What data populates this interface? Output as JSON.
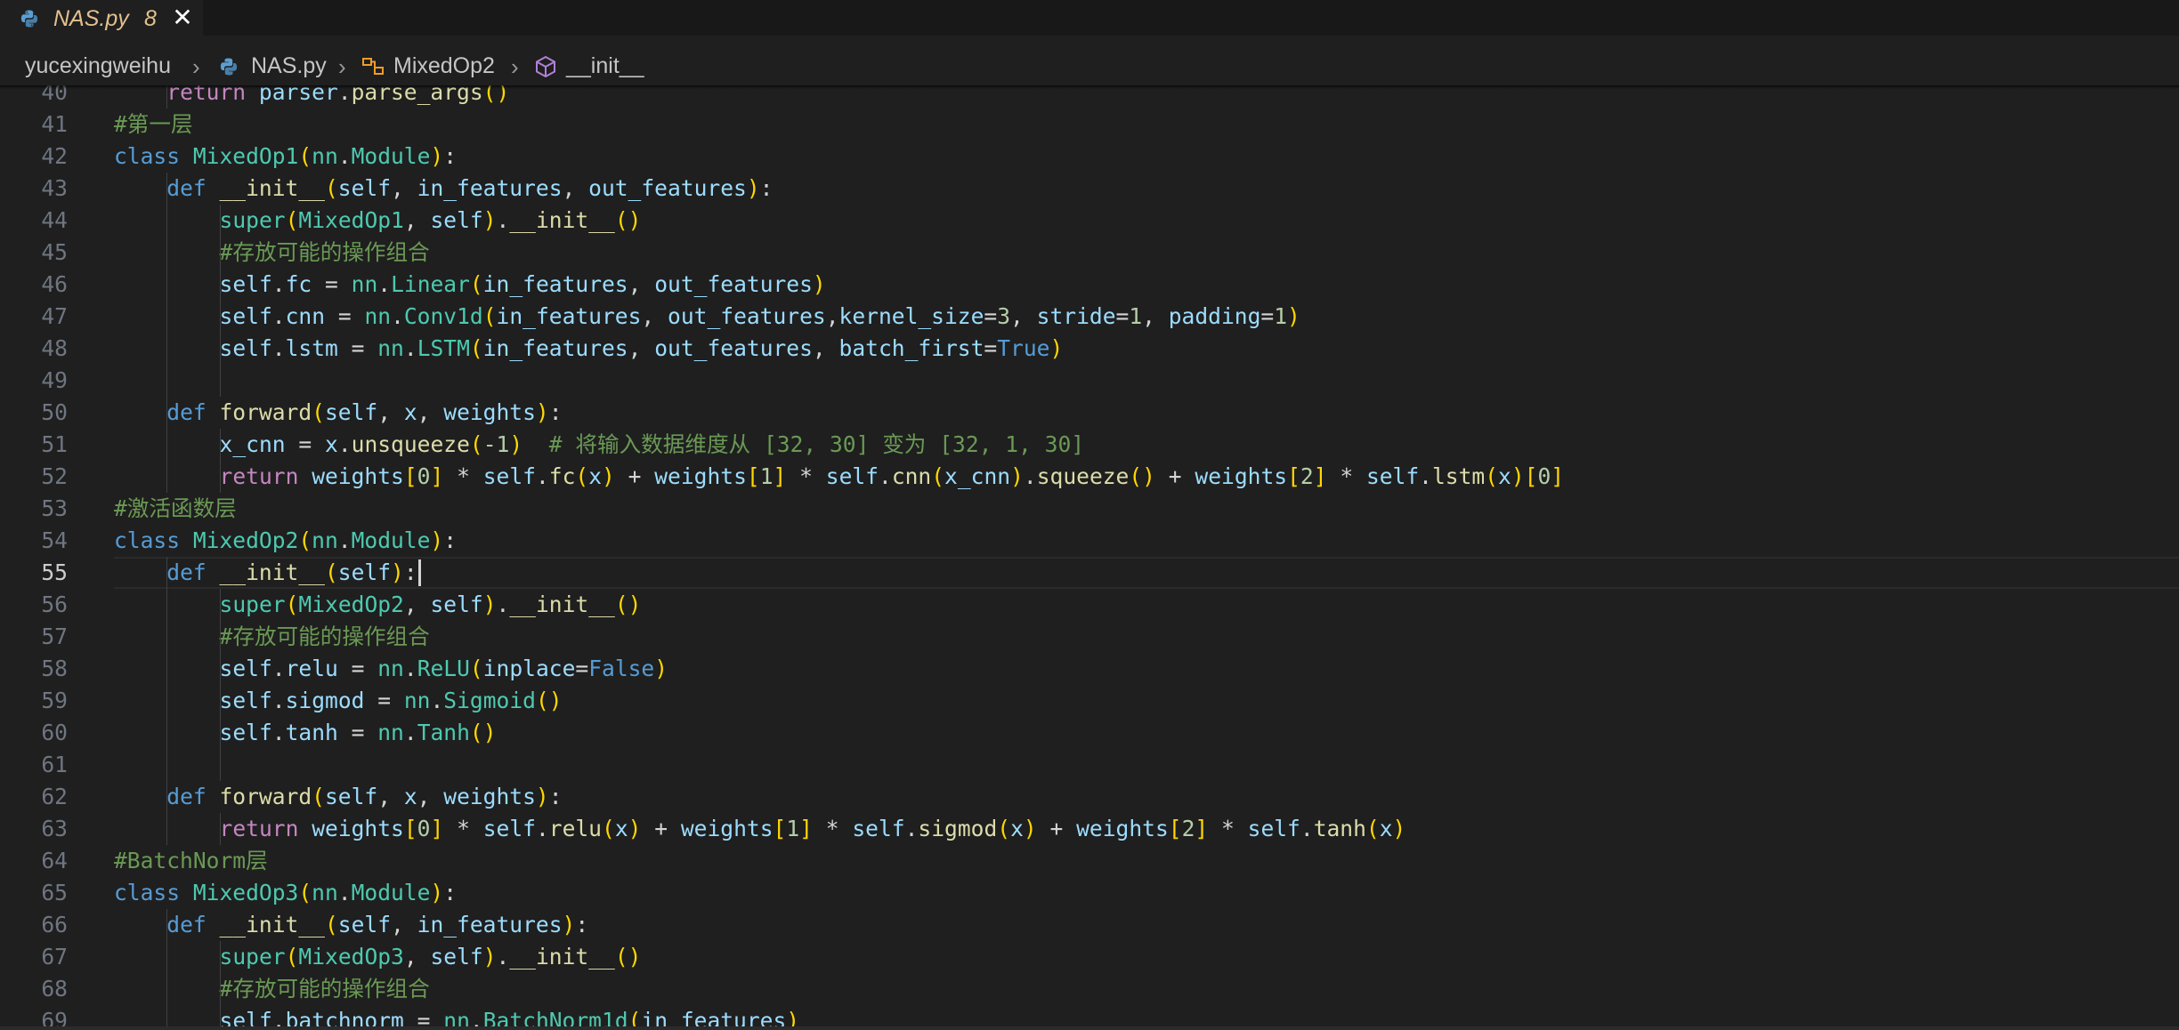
{
  "tab": {
    "filename": "NAS.py",
    "problem_count": "8",
    "close_symbol": "✕",
    "icon": "python-icon"
  },
  "breadcrumb": [
    {
      "label": "yucexingweihu",
      "icon": ""
    },
    {
      "label": "NAS.py",
      "icon": "python-icon"
    },
    {
      "label": "MixedOp2",
      "icon": "class-icon"
    },
    {
      "label": "__init__",
      "icon": "method-icon"
    }
  ],
  "colors": {
    "keyword": "#569cd6",
    "control": "#c586c0",
    "function": "#dcdcaa",
    "class": "#4ec9b0",
    "variable": "#9cdcfe",
    "number": "#b5cea8",
    "string": "#ce9178",
    "comment": "#6a9955",
    "bracket1": "#ffd700",
    "bracket2": "#da70d6",
    "bracket3": "#179fff",
    "plain": "#d4d4d4"
  },
  "current_line": 55,
  "lines": [
    {
      "n": "40",
      "indent": 1,
      "tokens": [
        [
          "return",
          "control"
        ],
        [
          " ",
          ""
        ],
        [
          "parser",
          "variable"
        ],
        [
          ".",
          ""
        ],
        [
          "parse_args",
          "function"
        ],
        [
          "()",
          "bracket1"
        ]
      ]
    },
    {
      "n": "41",
      "indent": 0,
      "tokens": [
        [
          "#第一层",
          "comment"
        ]
      ]
    },
    {
      "n": "42",
      "indent": 0,
      "tokens": [
        [
          "class",
          "keyword"
        ],
        [
          " ",
          ""
        ],
        [
          "MixedOp1",
          "class"
        ],
        [
          "(",
          "bracket1"
        ],
        [
          "nn",
          "class"
        ],
        [
          ".",
          ""
        ],
        [
          "Module",
          "class"
        ],
        [
          ")",
          "bracket1"
        ],
        [
          ":",
          ""
        ]
      ]
    },
    {
      "n": "43",
      "indent": 1,
      "tokens": [
        [
          "def",
          "keyword"
        ],
        [
          " ",
          ""
        ],
        [
          "__init__",
          "function"
        ],
        [
          "(",
          "bracket1"
        ],
        [
          "self",
          "variable"
        ],
        [
          ", ",
          ""
        ],
        [
          "in_features",
          "variable"
        ],
        [
          ", ",
          ""
        ],
        [
          "out_features",
          "variable"
        ],
        [
          ")",
          "bracket1"
        ],
        [
          ":",
          ""
        ]
      ]
    },
    {
      "n": "44",
      "indent": 2,
      "tokens": [
        [
          "super",
          "class"
        ],
        [
          "(",
          "bracket1"
        ],
        [
          "MixedOp1",
          "class"
        ],
        [
          ", ",
          ""
        ],
        [
          "self",
          "variable"
        ],
        [
          ")",
          "bracket1"
        ],
        [
          ".",
          ""
        ],
        [
          "__init__",
          "function"
        ],
        [
          "()",
          "bracket1"
        ]
      ]
    },
    {
      "n": "45",
      "indent": 2,
      "tokens": [
        [
          "#存放可能的操作组合",
          "comment"
        ]
      ]
    },
    {
      "n": "46",
      "indent": 2,
      "tokens": [
        [
          "self",
          "variable"
        ],
        [
          ".",
          ""
        ],
        [
          "fc",
          "variable"
        ],
        [
          " = ",
          ""
        ],
        [
          "nn",
          "class"
        ],
        [
          ".",
          ""
        ],
        [
          "Linear",
          "class"
        ],
        [
          "(",
          "bracket1"
        ],
        [
          "in_features",
          "variable"
        ],
        [
          ", ",
          ""
        ],
        [
          "out_features",
          "variable"
        ],
        [
          ")",
          "bracket1"
        ]
      ]
    },
    {
      "n": "47",
      "indent": 2,
      "tokens": [
        [
          "self",
          "variable"
        ],
        [
          ".",
          ""
        ],
        [
          "cnn",
          "variable"
        ],
        [
          " = ",
          ""
        ],
        [
          "nn",
          "class"
        ],
        [
          ".",
          ""
        ],
        [
          "Conv1d",
          "class"
        ],
        [
          "(",
          "bracket1"
        ],
        [
          "in_features",
          "variable"
        ],
        [
          ", ",
          ""
        ],
        [
          "out_features",
          "variable"
        ],
        [
          ",",
          ""
        ],
        [
          "kernel_size",
          "variable"
        ],
        [
          "=",
          ""
        ],
        [
          "3",
          "number"
        ],
        [
          ", ",
          ""
        ],
        [
          "stride",
          "variable"
        ],
        [
          "=",
          ""
        ],
        [
          "1",
          "number"
        ],
        [
          ", ",
          ""
        ],
        [
          "padding",
          "variable"
        ],
        [
          "=",
          ""
        ],
        [
          "1",
          "number"
        ],
        [
          ")",
          "bracket1"
        ]
      ]
    },
    {
      "n": "48",
      "indent": 2,
      "tokens": [
        [
          "self",
          "variable"
        ],
        [
          ".",
          ""
        ],
        [
          "lstm",
          "variable"
        ],
        [
          " = ",
          ""
        ],
        [
          "nn",
          "class"
        ],
        [
          ".",
          ""
        ],
        [
          "LSTM",
          "class"
        ],
        [
          "(",
          "bracket1"
        ],
        [
          "in_features",
          "variable"
        ],
        [
          ", ",
          ""
        ],
        [
          "out_features",
          "variable"
        ],
        [
          ", ",
          ""
        ],
        [
          "batch_first",
          "variable"
        ],
        [
          "=",
          ""
        ],
        [
          "True",
          "keyword"
        ],
        [
          ")",
          "bracket1"
        ]
      ]
    },
    {
      "n": "49",
      "indent": 0,
      "tokens": []
    },
    {
      "n": "50",
      "indent": 1,
      "tokens": [
        [
          "def",
          "keyword"
        ],
        [
          " ",
          ""
        ],
        [
          "forward",
          "function"
        ],
        [
          "(",
          "bracket1"
        ],
        [
          "self",
          "variable"
        ],
        [
          ", ",
          ""
        ],
        [
          "x",
          "variable"
        ],
        [
          ", ",
          ""
        ],
        [
          "weights",
          "variable"
        ],
        [
          ")",
          "bracket1"
        ],
        [
          ":",
          ""
        ]
      ]
    },
    {
      "n": "51",
      "indent": 2,
      "tokens": [
        [
          "x_cnn",
          "variable"
        ],
        [
          " = ",
          ""
        ],
        [
          "x",
          "variable"
        ],
        [
          ".",
          ""
        ],
        [
          "unsqueeze",
          "function"
        ],
        [
          "(",
          "bracket1"
        ],
        [
          "-1",
          "number"
        ],
        [
          ")",
          "bracket1"
        ],
        [
          "  ",
          ""
        ],
        [
          "# 将输入数据维度从 [32, 30] 变为 [32, 1, 30]",
          "comment"
        ]
      ]
    },
    {
      "n": "52",
      "indent": 2,
      "tokens": [
        [
          "return",
          "control"
        ],
        [
          " ",
          ""
        ],
        [
          "weights",
          "variable"
        ],
        [
          "[",
          "bracket1"
        ],
        [
          "0",
          "number"
        ],
        [
          "]",
          "bracket1"
        ],
        [
          " * ",
          ""
        ],
        [
          "self",
          "variable"
        ],
        [
          ".",
          ""
        ],
        [
          "fc",
          "function"
        ],
        [
          "(",
          "bracket1"
        ],
        [
          "x",
          "variable"
        ],
        [
          ")",
          "bracket1"
        ],
        [
          " + ",
          ""
        ],
        [
          "weights",
          "variable"
        ],
        [
          "[",
          "bracket1"
        ],
        [
          "1",
          "number"
        ],
        [
          "]",
          "bracket1"
        ],
        [
          " * ",
          ""
        ],
        [
          "self",
          "variable"
        ],
        [
          ".",
          ""
        ],
        [
          "cnn",
          "function"
        ],
        [
          "(",
          "bracket1"
        ],
        [
          "x_cnn",
          "variable"
        ],
        [
          ")",
          "bracket1"
        ],
        [
          ".",
          ""
        ],
        [
          "squeeze",
          "function"
        ],
        [
          "()",
          "bracket1"
        ],
        [
          " + ",
          ""
        ],
        [
          "weights",
          "variable"
        ],
        [
          "[",
          "bracket1"
        ],
        [
          "2",
          "number"
        ],
        [
          "]",
          "bracket1"
        ],
        [
          " * ",
          ""
        ],
        [
          "self",
          "variable"
        ],
        [
          ".",
          ""
        ],
        [
          "lstm",
          "function"
        ],
        [
          "(",
          "bracket1"
        ],
        [
          "x",
          "variable"
        ],
        [
          ")",
          "bracket1"
        ],
        [
          "[",
          "bracket1"
        ],
        [
          "0",
          "number"
        ],
        [
          "]",
          "bracket1"
        ]
      ]
    },
    {
      "n": "53",
      "indent": 0,
      "tokens": [
        [
          "#激活函数层",
          "comment"
        ]
      ]
    },
    {
      "n": "54",
      "indent": 0,
      "tokens": [
        [
          "class",
          "keyword"
        ],
        [
          " ",
          ""
        ],
        [
          "MixedOp2",
          "class"
        ],
        [
          "(",
          "bracket1"
        ],
        [
          "nn",
          "class"
        ],
        [
          ".",
          ""
        ],
        [
          "Module",
          "class"
        ],
        [
          ")",
          "bracket1"
        ],
        [
          ":",
          ""
        ]
      ]
    },
    {
      "n": "55",
      "indent": 1,
      "tokens": [
        [
          "def",
          "keyword"
        ],
        [
          " ",
          ""
        ],
        [
          "__init__",
          "function"
        ],
        [
          "(",
          "bracket1"
        ],
        [
          "self",
          "variable"
        ],
        [
          ")",
          "bracket1"
        ],
        [
          ":",
          ""
        ]
      ]
    },
    {
      "n": "56",
      "indent": 2,
      "tokens": [
        [
          "super",
          "class"
        ],
        [
          "(",
          "bracket1"
        ],
        [
          "MixedOp2",
          "class"
        ],
        [
          ", ",
          ""
        ],
        [
          "self",
          "variable"
        ],
        [
          ")",
          "bracket1"
        ],
        [
          ".",
          ""
        ],
        [
          "__init__",
          "function"
        ],
        [
          "()",
          "bracket1"
        ]
      ]
    },
    {
      "n": "57",
      "indent": 2,
      "tokens": [
        [
          "#存放可能的操作组合",
          "comment"
        ]
      ]
    },
    {
      "n": "58",
      "indent": 2,
      "tokens": [
        [
          "self",
          "variable"
        ],
        [
          ".",
          ""
        ],
        [
          "relu",
          "variable"
        ],
        [
          " = ",
          ""
        ],
        [
          "nn",
          "class"
        ],
        [
          ".",
          ""
        ],
        [
          "ReLU",
          "class"
        ],
        [
          "(",
          "bracket1"
        ],
        [
          "inplace",
          "variable"
        ],
        [
          "=",
          ""
        ],
        [
          "False",
          "keyword"
        ],
        [
          ")",
          "bracket1"
        ]
      ]
    },
    {
      "n": "59",
      "indent": 2,
      "tokens": [
        [
          "self",
          "variable"
        ],
        [
          ".",
          ""
        ],
        [
          "sigmod",
          "variable"
        ],
        [
          " = ",
          ""
        ],
        [
          "nn",
          "class"
        ],
        [
          ".",
          ""
        ],
        [
          "Sigmoid",
          "class"
        ],
        [
          "()",
          "bracket1"
        ]
      ]
    },
    {
      "n": "60",
      "indent": 2,
      "tokens": [
        [
          "self",
          "variable"
        ],
        [
          ".",
          ""
        ],
        [
          "tanh",
          "variable"
        ],
        [
          " = ",
          ""
        ],
        [
          "nn",
          "class"
        ],
        [
          ".",
          ""
        ],
        [
          "Tanh",
          "class"
        ],
        [
          "()",
          "bracket1"
        ]
      ]
    },
    {
      "n": "61",
      "indent": 0,
      "tokens": []
    },
    {
      "n": "62",
      "indent": 1,
      "tokens": [
        [
          "def",
          "keyword"
        ],
        [
          " ",
          ""
        ],
        [
          "forward",
          "function"
        ],
        [
          "(",
          "bracket1"
        ],
        [
          "self",
          "variable"
        ],
        [
          ", ",
          ""
        ],
        [
          "x",
          "variable"
        ],
        [
          ", ",
          ""
        ],
        [
          "weights",
          "variable"
        ],
        [
          ")",
          "bracket1"
        ],
        [
          ":",
          ""
        ]
      ]
    },
    {
      "n": "63",
      "indent": 2,
      "tokens": [
        [
          "return",
          "control"
        ],
        [
          " ",
          ""
        ],
        [
          "weights",
          "variable"
        ],
        [
          "[",
          "bracket1"
        ],
        [
          "0",
          "number"
        ],
        [
          "]",
          "bracket1"
        ],
        [
          " * ",
          ""
        ],
        [
          "self",
          "variable"
        ],
        [
          ".",
          ""
        ],
        [
          "relu",
          "function"
        ],
        [
          "(",
          "bracket1"
        ],
        [
          "x",
          "variable"
        ],
        [
          ")",
          "bracket1"
        ],
        [
          " + ",
          ""
        ],
        [
          "weights",
          "variable"
        ],
        [
          "[",
          "bracket1"
        ],
        [
          "1",
          "number"
        ],
        [
          "]",
          "bracket1"
        ],
        [
          " * ",
          ""
        ],
        [
          "self",
          "variable"
        ],
        [
          ".",
          ""
        ],
        [
          "sigmod",
          "function"
        ],
        [
          "(",
          "bracket1"
        ],
        [
          "x",
          "variable"
        ],
        [
          ")",
          "bracket1"
        ],
        [
          " + ",
          ""
        ],
        [
          "weights",
          "variable"
        ],
        [
          "[",
          "bracket1"
        ],
        [
          "2",
          "number"
        ],
        [
          "]",
          "bracket1"
        ],
        [
          " * ",
          ""
        ],
        [
          "self",
          "variable"
        ],
        [
          ".",
          ""
        ],
        [
          "tanh",
          "function"
        ],
        [
          "(",
          "bracket1"
        ],
        [
          "x",
          "variable"
        ],
        [
          ")",
          "bracket1"
        ]
      ]
    },
    {
      "n": "64",
      "indent": 0,
      "tokens": [
        [
          "#BatchNorm层",
          "comment"
        ]
      ]
    },
    {
      "n": "65",
      "indent": 0,
      "tokens": [
        [
          "class",
          "keyword"
        ],
        [
          " ",
          ""
        ],
        [
          "MixedOp3",
          "class"
        ],
        [
          "(",
          "bracket1"
        ],
        [
          "nn",
          "class"
        ],
        [
          ".",
          ""
        ],
        [
          "Module",
          "class"
        ],
        [
          ")",
          "bracket1"
        ],
        [
          ":",
          ""
        ]
      ]
    },
    {
      "n": "66",
      "indent": 1,
      "tokens": [
        [
          "def",
          "keyword"
        ],
        [
          " ",
          ""
        ],
        [
          "__init__",
          "function"
        ],
        [
          "(",
          "bracket1"
        ],
        [
          "self",
          "variable"
        ],
        [
          ", ",
          ""
        ],
        [
          "in_features",
          "variable"
        ],
        [
          ")",
          "bracket1"
        ],
        [
          ":",
          ""
        ]
      ]
    },
    {
      "n": "67",
      "indent": 2,
      "tokens": [
        [
          "super",
          "class"
        ],
        [
          "(",
          "bracket1"
        ],
        [
          "MixedOp3",
          "class"
        ],
        [
          ", ",
          ""
        ],
        [
          "self",
          "variable"
        ],
        [
          ")",
          "bracket1"
        ],
        [
          ".",
          ""
        ],
        [
          "__init__",
          "function"
        ],
        [
          "()",
          "bracket1"
        ]
      ]
    },
    {
      "n": "68",
      "indent": 2,
      "tokens": [
        [
          "#存放可能的操作组合",
          "comment"
        ]
      ]
    },
    {
      "n": "69",
      "indent": 2,
      "tokens": [
        [
          "self",
          "variable"
        ],
        [
          ".",
          ""
        ],
        [
          "batchnorm",
          "variable"
        ],
        [
          " = ",
          ""
        ],
        [
          "nn",
          "class"
        ],
        [
          ".",
          ""
        ],
        [
          "BatchNorm1d",
          "class"
        ],
        [
          "(",
          "bracket1"
        ],
        [
          "in_features",
          "variable"
        ],
        [
          ")",
          "bracket1"
        ]
      ]
    }
  ]
}
